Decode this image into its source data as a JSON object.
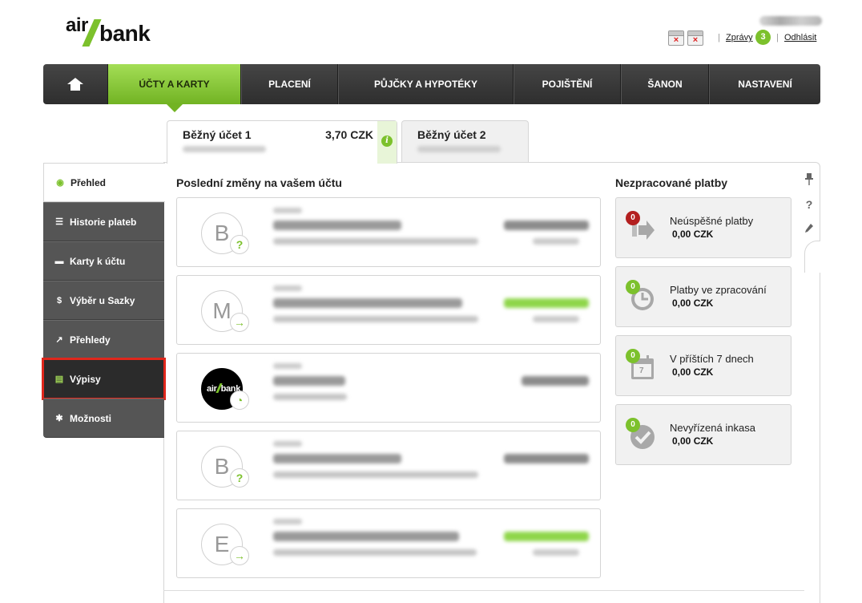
{
  "header": {
    "logo_air": "air",
    "logo_bank": "bank",
    "logo_alt": "air/bank",
    "calendar_marks": [
      "×",
      "×"
    ],
    "messages_label": "Zprávy",
    "messages_count": "3",
    "logout_label": "Odhlásit",
    "separator": "|"
  },
  "nav": {
    "items": [
      {
        "label": "",
        "icon": "home-icon"
      },
      {
        "label": "ÚČTY A KARTY"
      },
      {
        "label": "PLACENÍ"
      },
      {
        "label": "PŮJČKY A HYPOTÉKY"
      },
      {
        "label": "POJIŠTĚNÍ"
      },
      {
        "label": "ŠANON"
      },
      {
        "label": "NASTAVENÍ"
      }
    ]
  },
  "accounts": [
    {
      "name": "Běžný účet 1",
      "balance": "3,70 CZK",
      "info_icon": "i"
    },
    {
      "name": "Běžný účet 2"
    }
  ],
  "sidebar": {
    "items": [
      {
        "label": "Přehled",
        "icon": "eye-icon",
        "glyph": "◉"
      },
      {
        "label": "Historie plateb",
        "icon": "list-icon",
        "glyph": "☰"
      },
      {
        "label": "Karty k účtu",
        "icon": "card-icon",
        "glyph": "▬"
      },
      {
        "label": "Výběr u Sazky",
        "icon": "dollar-icon",
        "glyph": "$"
      },
      {
        "label": "Přehledy",
        "icon": "chart-icon",
        "glyph": "↗"
      },
      {
        "label": "Výpisy",
        "icon": "document-icon",
        "glyph": "▤"
      },
      {
        "label": "Možnosti",
        "icon": "gear-icon",
        "glyph": "✱"
      }
    ]
  },
  "recent": {
    "title": "Poslední změny na vašem účtu",
    "transactions": [
      {
        "avatar": "B",
        "badge": "?"
      },
      {
        "avatar": "M",
        "badge": "→"
      },
      {
        "avatar_logo": "air/bank",
        "badge": "◔"
      },
      {
        "avatar": "B",
        "badge": "?"
      },
      {
        "avatar": "E",
        "badge": "→"
      }
    ]
  },
  "pending": {
    "title": "Nezpracované platby",
    "items": [
      {
        "label": "Neúspěšné platby",
        "count": "0",
        "amount": "0,00 CZK"
      },
      {
        "label": "Platby ve zpracování",
        "count": "0",
        "amount": "0,00 CZK"
      },
      {
        "label": "V příštích 7 dnech",
        "count": "0",
        "amount": "0,00 CZK",
        "calendar_day": "7"
      },
      {
        "label": "Nevyřízená inkasa",
        "count": "0",
        "amount": "0,00 CZK"
      }
    ]
  },
  "tools": {
    "help": "?"
  },
  "colors": {
    "accent": "#7cc12c",
    "nav_dark": "#3a3a3a",
    "sidebar": "#555555",
    "alert": "#b31f1f",
    "highlight": "#e0271c"
  }
}
